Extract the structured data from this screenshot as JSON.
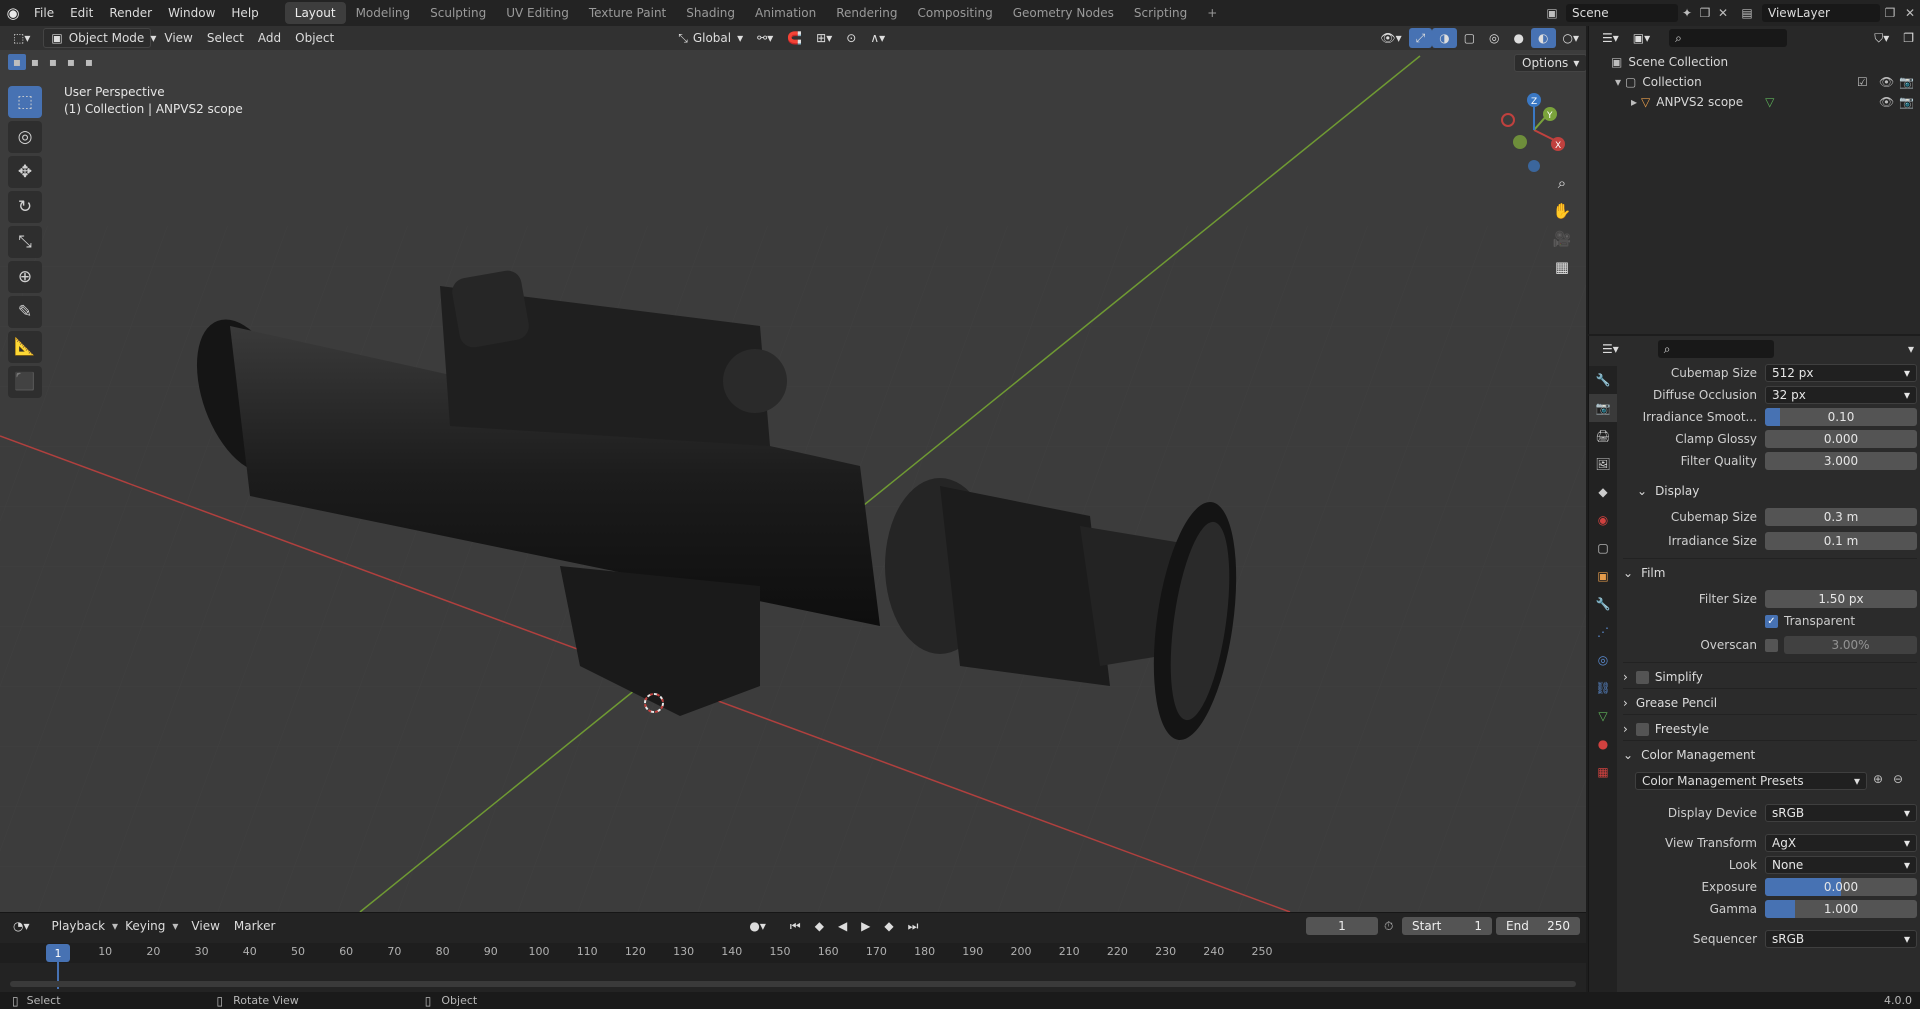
{
  "topbar": {
    "menus": [
      "File",
      "Edit",
      "Render",
      "Window",
      "Help"
    ],
    "workspaces": [
      "Layout",
      "Modeling",
      "Sculpting",
      "UV Editing",
      "Texture Paint",
      "Shading",
      "Animation",
      "Rendering",
      "Compositing",
      "Geometry Nodes",
      "Scripting"
    ],
    "active_workspace": "Layout",
    "add_tab": "+",
    "scene": "Scene",
    "view_layer": "ViewLayer"
  },
  "viewport": {
    "mode": "Object Mode",
    "menus": [
      "View",
      "Select",
      "Add",
      "Object"
    ],
    "orientation": "Global",
    "options_label": "Options",
    "info_line1": "User Perspective",
    "info_line2": "(1) Collection | ANPVS2 scope",
    "gizmo": {
      "x": "X",
      "y": "Y",
      "z": "Z"
    }
  },
  "timeline": {
    "menus": [
      "Playback",
      "Keying",
      "View",
      "Marker"
    ],
    "current_frame": "1",
    "start_label": "Start",
    "start_value": "1",
    "end_label": "End",
    "end_value": "250",
    "ticks": [
      "10",
      "20",
      "30",
      "40",
      "50",
      "60",
      "70",
      "80",
      "90",
      "100",
      "110",
      "120",
      "130",
      "140",
      "150",
      "160",
      "170",
      "180",
      "190",
      "200",
      "210",
      "220",
      "230",
      "240",
      "250"
    ],
    "frame_marker": "1"
  },
  "statusbar": {
    "select": "Select",
    "rotate": "Rotate View",
    "object": "Object",
    "version": "4.0.0"
  },
  "outliner": {
    "scene_collection": "Scene Collection",
    "collection": "Collection",
    "object": "ANPVS2 scope"
  },
  "properties": {
    "cubemap_size_label": "Cubemap Size",
    "cubemap_size_value": "512 px",
    "diffuse_occlusion_label": "Diffuse Occlusion",
    "diffuse_occlusion_value": "32 px",
    "irradiance_smooth_label": "Irradiance Smoot...",
    "irradiance_smooth_value": "0.10",
    "irradiance_smooth_fraction": 0.1,
    "clamp_glossy_label": "Clamp Glossy",
    "clamp_glossy_value": "0.000",
    "filter_quality_label": "Filter Quality",
    "filter_quality_value": "3.000",
    "display_header": "Display",
    "display_cubemap_label": "Cubemap Size",
    "display_cubemap_value": "0.3 m",
    "display_irradiance_label": "Irradiance Size",
    "display_irradiance_value": "0.1 m",
    "film_header": "Film",
    "filter_size_label": "Filter Size",
    "filter_size_value": "1.50 px",
    "transparent_label": "Transparent",
    "overscan_label": "Overscan",
    "overscan_value": "3.00%",
    "simplify_header": "Simplify",
    "grease_pencil_header": "Grease Pencil",
    "freestyle_header": "Freestyle",
    "color_mgmt_header": "Color Management",
    "color_mgmt_presets": "Color Management Presets",
    "display_device_label": "Display Device",
    "display_device_value": "sRGB",
    "view_transform_label": "View Transform",
    "view_transform_value": "AgX",
    "look_label": "Look",
    "look_value": "None",
    "exposure_label": "Exposure",
    "exposure_value": "0.000",
    "exposure_fraction": 0.5,
    "gamma_label": "Gamma",
    "gamma_value": "1.000",
    "gamma_fraction": 0.2,
    "sequencer_label": "Sequencer",
    "sequencer_value": "sRGB"
  },
  "colors": {
    "accent": "#4772b3",
    "x_axis": "#c0413e",
    "y_axis": "#7aa33b",
    "z_axis": "#3a78c4"
  }
}
